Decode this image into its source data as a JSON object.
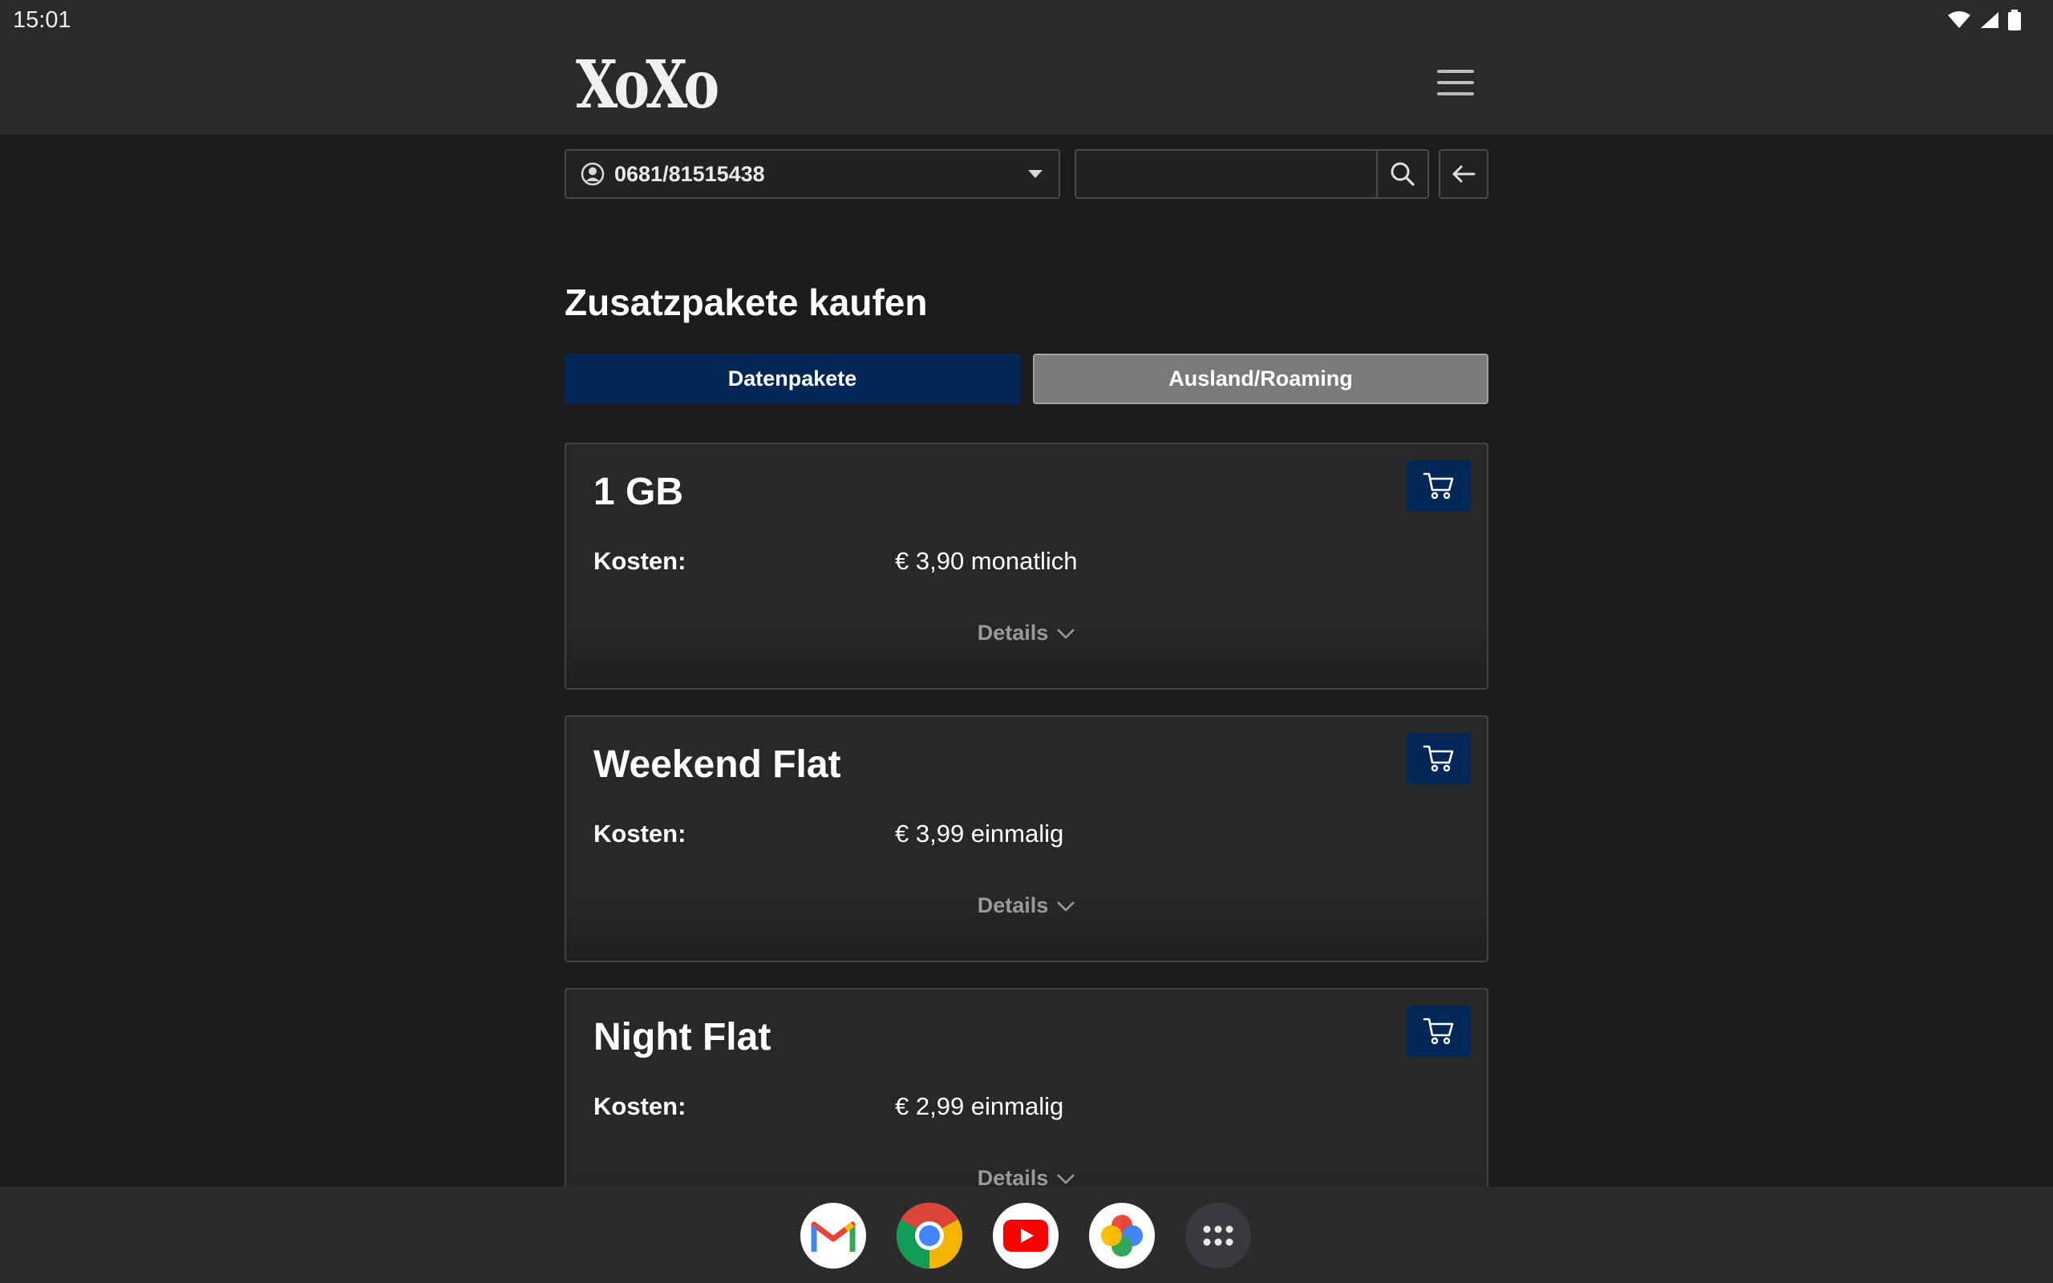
{
  "status_bar": {
    "time": "15:01",
    "icons": [
      "wifi-icon",
      "signal-icon",
      "battery-icon"
    ]
  },
  "header": {
    "logo_text": "XoXo",
    "menu_icon": "hamburger-menu-icon"
  },
  "controls": {
    "phone_number": "0681/81515438",
    "search_value": "",
    "search_placeholder": ""
  },
  "page": {
    "title": "Zusatzpakete kaufen",
    "tabs": [
      {
        "label": "Datenpakete",
        "active": true
      },
      {
        "label": "Ausland/Roaming",
        "active": false
      }
    ]
  },
  "packages": [
    {
      "title": "1 GB",
      "cost_label": "Kosten:",
      "cost_value": "€ 3,90 monatlich",
      "details_label": "Details"
    },
    {
      "title": "Weekend Flat",
      "cost_label": "Kosten:",
      "cost_value": "€ 3,99 einmalig",
      "details_label": "Details"
    },
    {
      "title": "Night Flat",
      "cost_label": "Kosten:",
      "cost_value": "€ 2,99 einmalig",
      "details_label": "Details"
    }
  ],
  "taskbar": {
    "apps": [
      "gmail-icon",
      "chrome-icon",
      "youtube-icon",
      "photos-icon",
      "app-launcher-icon"
    ]
  },
  "colors": {
    "background": "#1c1c1f",
    "header": "#2a2a2d",
    "accent": "#032858",
    "inactive_tab": "#7a7a7a"
  }
}
